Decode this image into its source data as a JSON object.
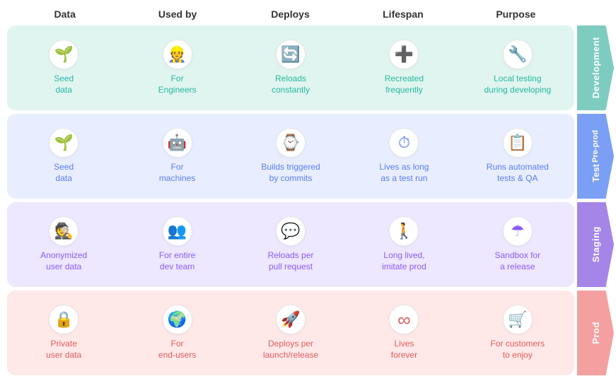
{
  "header": {
    "columns": [
      "Data",
      "Used by",
      "Deploys",
      "Lifespan",
      "Purpose"
    ]
  },
  "sections": [
    {
      "id": "dev",
      "label": "Development",
      "bg": "#e0f5f0",
      "arrowBg": "#7eccc0",
      "iconColor": "#26b89e",
      "textColor": "#26b89e",
      "cells": [
        {
          "icon": "🌱",
          "label": "Seed\ndata"
        },
        {
          "icon": "👷",
          "label": "For\nEngineers"
        },
        {
          "icon": "🔄",
          "label": "Reloads\nconstantly"
        },
        {
          "icon": "➕",
          "label": "Recreated\nfrequently"
        },
        {
          "icon": "🔧",
          "label": "Local testing\nduring developing"
        }
      ]
    },
    {
      "id": "test",
      "label": "Pre-prod",
      "sublabel": "Test",
      "bg": "#e8eeff",
      "arrowBg": "#7b9ff5",
      "iconColor": "#5b7cf5",
      "textColor": "#5b7cf5",
      "cells": [
        {
          "icon": "🌱",
          "label": "Seed\ndata"
        },
        {
          "icon": "🤖",
          "label": "For\nmachines"
        },
        {
          "icon": "⌚",
          "label": "Builds triggered\nby commits"
        },
        {
          "icon": "⏱",
          "label": "Lives as long\nas a test run"
        },
        {
          "icon": "📋",
          "label": "Runs automated\ntests & QA"
        }
      ]
    },
    {
      "id": "staging",
      "label": "Staging",
      "bg": "#ede7ff",
      "arrowBg": "#a585e8",
      "iconColor": "#8b5cf6",
      "textColor": "#8b5cf6",
      "cells": [
        {
          "icon": "🕵",
          "label": "Anonymized\nuser data"
        },
        {
          "icon": "👥",
          "label": "For entire\ndev team"
        },
        {
          "icon": "💬",
          "label": "Reloads per\npull request"
        },
        {
          "icon": "🚶",
          "label": "Long lived,\nimitate prod"
        },
        {
          "icon": "☂",
          "label": "Sandbox for\na release"
        }
      ]
    },
    {
      "id": "prod",
      "label": "Prod",
      "bg": "#ffe8e8",
      "arrowBg": "#f5a0a0",
      "iconColor": "#e05c5c",
      "textColor": "#e05c5c",
      "cells": [
        {
          "icon": "🔒",
          "label": "Private\nuser data"
        },
        {
          "icon": "🌍",
          "label": "For\nend-users"
        },
        {
          "icon": "🚀",
          "label": "Deploys per\nlaunch/release"
        },
        {
          "icon": "∞",
          "label": "Lives\nforever"
        },
        {
          "icon": "🛒",
          "label": "For customers\nto enjoy"
        }
      ]
    }
  ]
}
